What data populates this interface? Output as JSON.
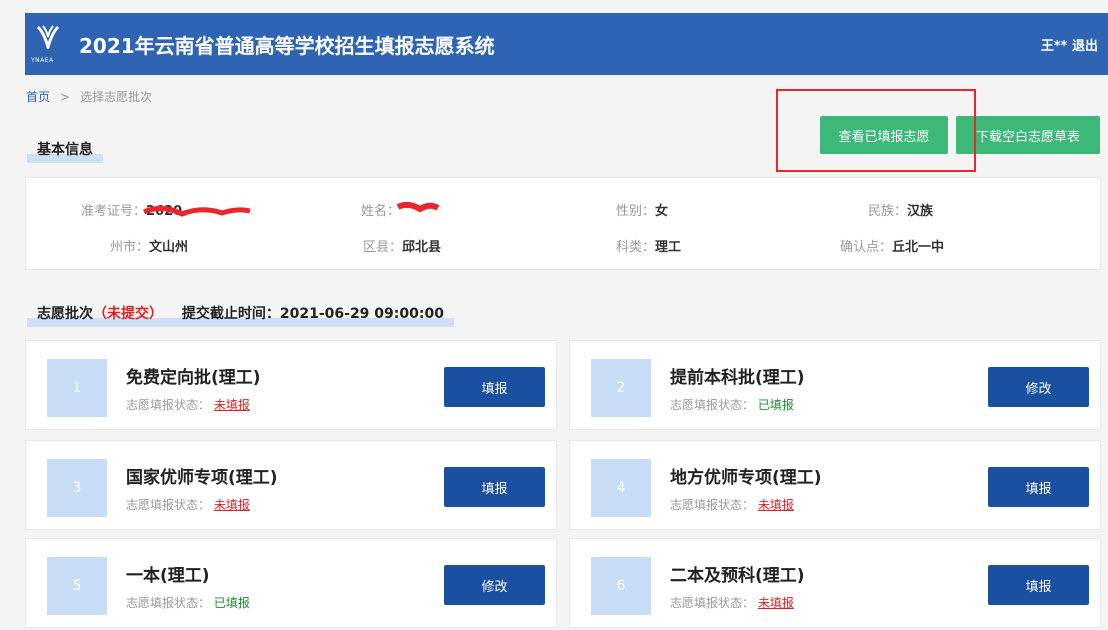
{
  "header": {
    "logo_text": "YNAEA",
    "title": "2021年云南省普通高等学校招生填报志愿系统",
    "user_name": "王**",
    "logout_label": "退出",
    "bg_color": "#2f63b3"
  },
  "breadcrumb": {
    "home": "首页",
    "separator": ">",
    "current": "选择志愿批次"
  },
  "actions": {
    "view_filled_label": "查看已填报志愿",
    "download_blank_label": "下载空白志愿草表"
  },
  "basic_info": {
    "title": "基本信息",
    "exam_no_label": "准考证号：",
    "exam_no_value": "2620",
    "name_label": "姓名：",
    "name_value": "",
    "gender_label": "性别：",
    "gender_value": "女",
    "ethnicity_label": "民族：",
    "ethnicity_value": "汉族",
    "city_label": "州市：",
    "city_value": "文山州",
    "county_label": "区县：",
    "county_value": "邱北县",
    "subject_label": "科类：",
    "subject_value": "理工",
    "confirm_label": "确认点：",
    "confirm_value": "丘北一中"
  },
  "batch_section": {
    "title_prefix": "志愿批次",
    "submit_status": "（未提交）",
    "deadline_label": "提交截止时间：",
    "deadline_value": "2021-06-29 09:00:00"
  },
  "status_label": "志愿填报状态：",
  "batches": [
    {
      "num": "1",
      "name": "免费定向批(理工)",
      "status": "未填报",
      "button": "填报"
    },
    {
      "num": "2",
      "name": "提前本科批(理工)",
      "status": "已填报",
      "button": "修改"
    },
    {
      "num": "3",
      "name": "国家优师专项(理工)",
      "status": "未填报",
      "button": "填报"
    },
    {
      "num": "4",
      "name": "地方优师专项(理工)",
      "status": "未填报",
      "button": "填报"
    },
    {
      "num": "5",
      "name": "一本(理工)",
      "status": "已填报",
      "button": "修改"
    },
    {
      "num": "6",
      "name": "二本及预科(理工)",
      "status": "未填报",
      "button": "填报"
    }
  ]
}
